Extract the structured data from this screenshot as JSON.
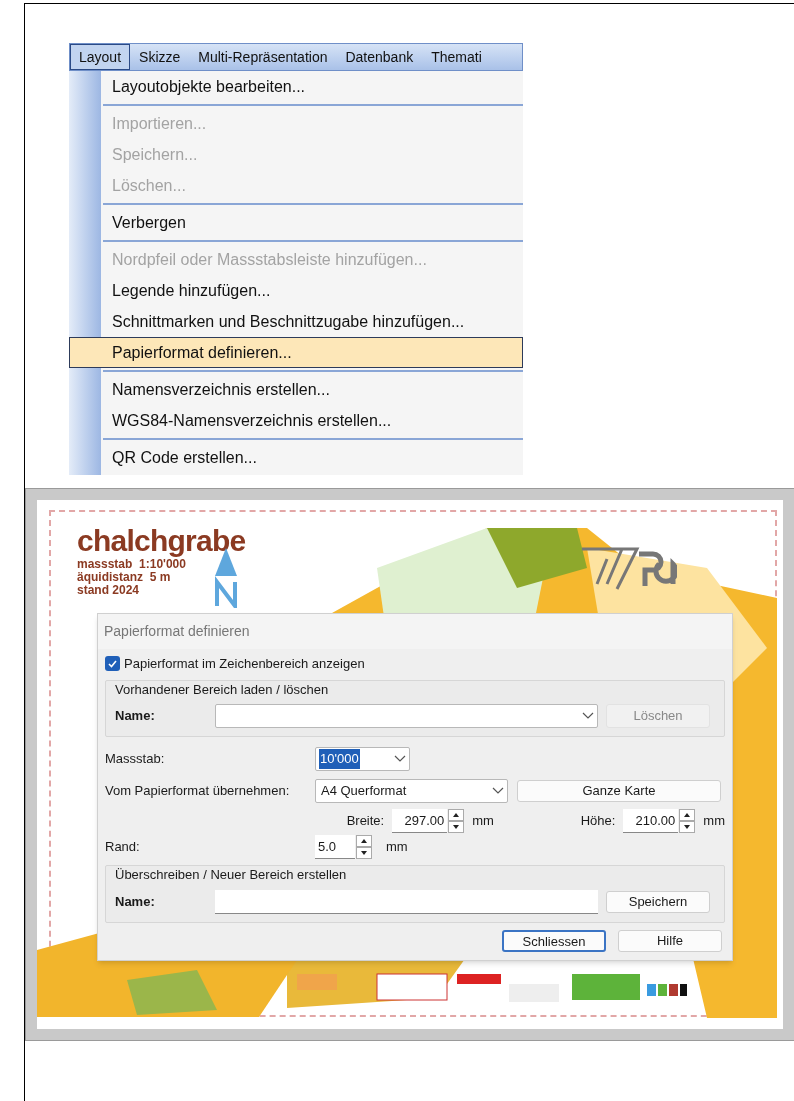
{
  "menu_bar": {
    "items": [
      {
        "label": "Layout",
        "selected": true
      },
      {
        "label": "Skizze",
        "selected": false
      },
      {
        "label": "Multi-Repräsentation",
        "selected": false
      },
      {
        "label": "Datenbank",
        "selected": false
      },
      {
        "label": "Themati",
        "selected": false
      }
    ]
  },
  "menu": {
    "items": [
      {
        "kind": "item",
        "label": "Layoutobjekte bearbeiten...",
        "disabled": false,
        "selected": false
      },
      {
        "kind": "separator"
      },
      {
        "kind": "item",
        "label": "Importieren...",
        "disabled": true,
        "selected": false
      },
      {
        "kind": "item",
        "label": "Speichern...",
        "disabled": true,
        "selected": false
      },
      {
        "kind": "item",
        "label": "Löschen...",
        "disabled": true,
        "selected": false
      },
      {
        "kind": "separator"
      },
      {
        "kind": "item",
        "label": "Verbergen",
        "disabled": false,
        "selected": false
      },
      {
        "kind": "separator"
      },
      {
        "kind": "item",
        "label": "Nordpfeil oder Massstabsleiste hinzufügen...",
        "disabled": true,
        "selected": false
      },
      {
        "kind": "item",
        "label": "Legende hinzufügen...",
        "disabled": false,
        "selected": false
      },
      {
        "kind": "item",
        "label": "Schnittmarken und Beschnittzugabe hinzufügen...",
        "disabled": false,
        "selected": false
      },
      {
        "kind": "item",
        "label": "Papierformat definieren...",
        "disabled": false,
        "selected": true
      },
      {
        "kind": "separator"
      },
      {
        "kind": "item",
        "label": "Namensverzeichnis erstellen...",
        "disabled": false,
        "selected": false
      },
      {
        "kind": "item",
        "label": "WGS84-Namensverzeichnis erstellen...",
        "disabled": false,
        "selected": false
      },
      {
        "kind": "separator"
      },
      {
        "kind": "item",
        "label": "QR Code erstellen...",
        "disabled": false,
        "selected": false
      }
    ]
  },
  "map": {
    "title": "chalchgrabe",
    "info": [
      "massstab  1:10'000",
      "äquidistanz  5 m",
      "stand 2024"
    ]
  },
  "dialog": {
    "title": "Papierformat definieren",
    "show_checkbox": {
      "label": "Papierformat im Zeichenbereich anzeigen",
      "checked": true
    },
    "load_group": {
      "legend": "Vorhandener Bereich laden / löschen",
      "name_label": "Name:",
      "delete_button": {
        "label": "Löschen",
        "disabled": true
      }
    },
    "scale": {
      "label": "Massstab:",
      "value": "10'000"
    },
    "paper": {
      "label": "Vom Papierformat übernehmen:",
      "value": "A4 Querformat",
      "button": "Ganze Karte"
    },
    "width": {
      "label": "Breite:",
      "value": "297.00",
      "unit": "mm"
    },
    "height": {
      "label": "Höhe:",
      "value": "210.00",
      "unit": "mm"
    },
    "margin": {
      "label": "Rand:",
      "value": "5.0",
      "unit": "mm"
    },
    "save_group": {
      "legend": "Überschreiben / Neuer Bereich erstellen",
      "name_label": "Name:",
      "save_button": "Speichern"
    },
    "buttons": [
      {
        "label": "Schliessen",
        "default": true
      },
      {
        "label": "Hilfe",
        "default": false
      }
    ]
  }
}
